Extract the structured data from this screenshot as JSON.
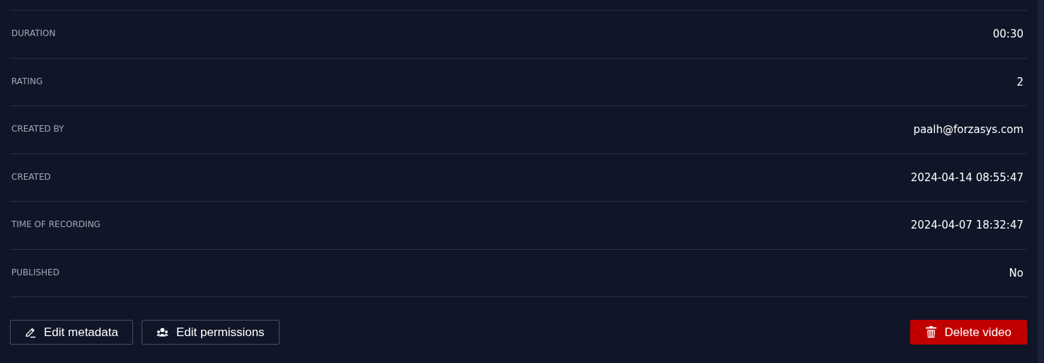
{
  "details": [
    {
      "label": "DURATION",
      "value": "00:30"
    },
    {
      "label": "RATING",
      "value": "2"
    },
    {
      "label": "CREATED BY",
      "value": "paalh@forzasys.com"
    },
    {
      "label": "CREATED",
      "value": "2024-04-14 08:55:47"
    },
    {
      "label": "TIME OF RECORDING",
      "value": "2024-04-07 18:32:47"
    },
    {
      "label": "PUBLISHED",
      "value": "No"
    }
  ],
  "actions": [
    {
      "label": "Edit metadata",
      "kind": "edit"
    },
    {
      "label": "Edit permissions",
      "kind": "permissions"
    },
    {
      "label": "Delete video",
      "kind": "delete"
    }
  ]
}
